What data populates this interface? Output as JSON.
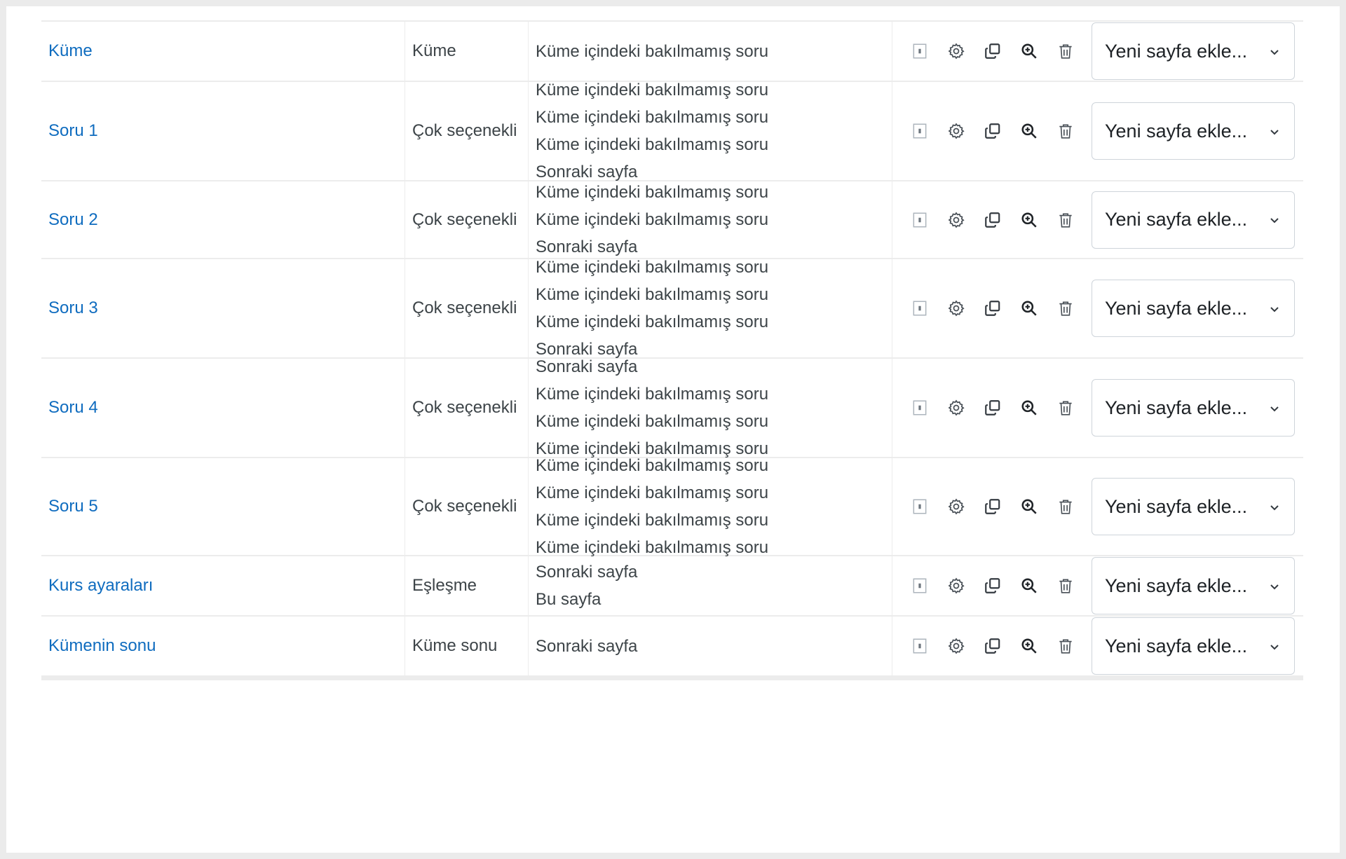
{
  "colors": {
    "link": "#0f6cbf",
    "text": "#3d4448",
    "icon": "#495057",
    "border": "#ececec"
  },
  "row_icons": [
    "move-icon",
    "gear-icon",
    "copy-icon",
    "zoom-in-icon",
    "trash-icon"
  ],
  "rows": [
    {
      "name": "Küme",
      "type": "Küme",
      "jumps": [
        "Küme içindeki bakılmamış soru"
      ],
      "select": "Yeni sayfa ekle..."
    },
    {
      "name": "Soru 1",
      "type": "Çok seçenekli",
      "jumps": [
        "Küme içindeki bakılmamış soru",
        "Küme içindeki bakılmamış soru",
        "Küme içindeki bakılmamış soru",
        "Sonraki sayfa"
      ],
      "select": "Yeni sayfa ekle..."
    },
    {
      "name": "Soru 2",
      "type": "Çok seçenekli",
      "jumps": [
        "Küme içindeki bakılmamış soru",
        "Küme içindeki bakılmamış soru",
        "Sonraki sayfa"
      ],
      "select": "Yeni sayfa ekle..."
    },
    {
      "name": "Soru 3",
      "type": "Çok seçenekli",
      "jumps": [
        "Küme içindeki bakılmamış soru",
        "Küme içindeki bakılmamış soru",
        "Küme içindeki bakılmamış soru",
        "Sonraki sayfa"
      ],
      "select": "Yeni sayfa ekle..."
    },
    {
      "name": "Soru 4",
      "type": "Çok seçenekli",
      "jumps": [
        "Sonraki sayfa",
        "Küme içindeki bakılmamış soru",
        "Küme içindeki bakılmamış soru",
        "Küme içindeki bakılmamış soru"
      ],
      "select": "Yeni sayfa ekle..."
    },
    {
      "name": "Soru 5",
      "type": "Çok seçenekli",
      "jumps": [
        "Küme içindeki bakılmamış soru",
        "Küme içindeki bakılmamış soru",
        "Küme içindeki bakılmamış soru",
        "Küme içindeki bakılmamış soru"
      ],
      "select": "Yeni sayfa ekle..."
    },
    {
      "name": "Kurs ayaraları",
      "type": "Eşleşme",
      "jumps": [
        "Sonraki sayfa",
        "Bu sayfa"
      ],
      "select": "Yeni sayfa ekle..."
    },
    {
      "name": "Kümenin sonu",
      "type": "Küme sonu",
      "jumps": [
        "Sonraki sayfa"
      ],
      "select": "Yeni sayfa ekle..."
    }
  ]
}
